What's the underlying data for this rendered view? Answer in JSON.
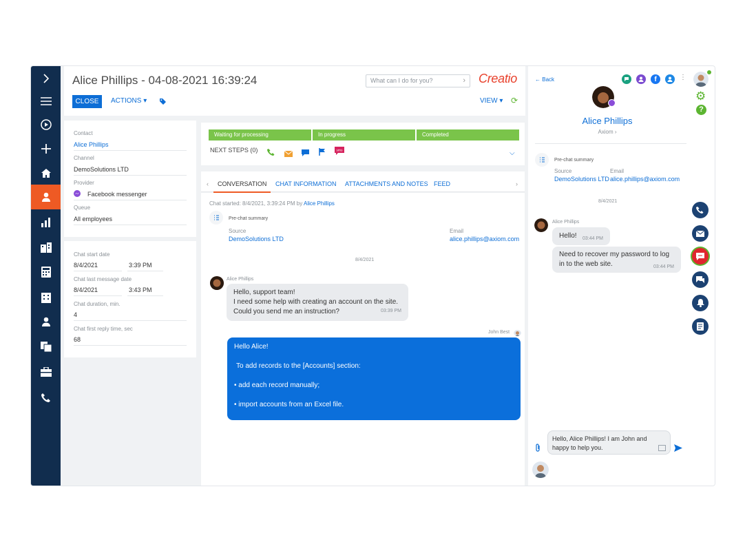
{
  "header": {
    "title": "Alice Phillips - 04-08-2021 16:39:24",
    "close_label": "CLOSE",
    "actions_label": "ACTIONS",
    "search_placeholder": "What can I do for you?",
    "logo": "Creatio",
    "view_label": "VIEW"
  },
  "nav": {
    "items": [
      "expand-icon",
      "menu-icon",
      "play-icon",
      "add-icon",
      "home-icon",
      "contact-icon",
      "chart-icon",
      "accounts-icon",
      "calculator-icon",
      "building-icon",
      "person-icon",
      "documents-icon",
      "cases-icon",
      "phone-icon"
    ]
  },
  "details": {
    "contact_label": "Contact",
    "contact_value": "Alice Phillips",
    "channel_label": "Channel",
    "channel_value": "DemoSolutions LTD",
    "provider_label": "Provider",
    "provider_value": "Facebook messenger",
    "queue_label": "Queue",
    "queue_value": "All employees"
  },
  "stats": {
    "start_label": "Chat start date",
    "start_date": "8/4/2021",
    "start_time": "3:39 PM",
    "last_label": "Chat last message date",
    "last_date": "8/4/2021",
    "last_time": "3:43 PM",
    "duration_label": "Chat duration, min.",
    "duration_value": "4",
    "reply_label": "Chat first reply time, sec",
    "reply_value": "68"
  },
  "stages": [
    "Waiting for processing",
    "In progress",
    "Completed"
  ],
  "next_steps_label": "NEXT STEPS (0)",
  "tabs": [
    "CONVERSATION",
    "CHAT INFORMATION",
    "ATTACHMENTS AND NOTES",
    "FEED"
  ],
  "conversation": {
    "started_prefix": "Chat started: 8/4/2021, 3:39:24 PM by",
    "started_by": "Alice Phillips",
    "summary_label": "Pre-chat summary",
    "source_label": "Source",
    "source_value": "DemoSolutions LTD",
    "email_label": "Email",
    "email_value": "alice.phillips@axiom.com",
    "date": "8/4/2021",
    "in_sender": "Alice Phillips",
    "in_line1": "Hello, support team!",
    "in_line2": "I need some help with creating an account on the site.",
    "in_line3": "Could you send me an instruction?",
    "in_time": "03:39 PM",
    "out_sender": "John Best",
    "out_line1": "Hello Alice!",
    "out_line2": "To add records to the [Accounts] section:",
    "out_line3": "• add each record manually;",
    "out_line4": "• import accounts from an Excel file."
  },
  "right_panel": {
    "back_label": "Back",
    "name": "Alice Phillips",
    "company": "Axiom",
    "summary_label": "Pre-chat summary",
    "source_label": "Source",
    "source_value": "DemoSolutions LTD",
    "email_label": "Email",
    "email_value": "alice.phillips@axiom.com",
    "date": "8/4/2021",
    "sender": "Alice Phillips",
    "msg1": "Hello!",
    "msg1_time": "03:44 PM",
    "msg2_line1": "Need to recover my password to log",
    "msg2_line2": "in to the web site.",
    "msg2_time": "03:44 PM",
    "composer_line1": "Hello, Alice Phillips! I am John and",
    "composer_line2": "happy to help you."
  },
  "colors": {
    "brand": "#0d6ed6",
    "nav": "#112d4e",
    "accent": "#ee5a24",
    "stage": "#7ac44a"
  }
}
